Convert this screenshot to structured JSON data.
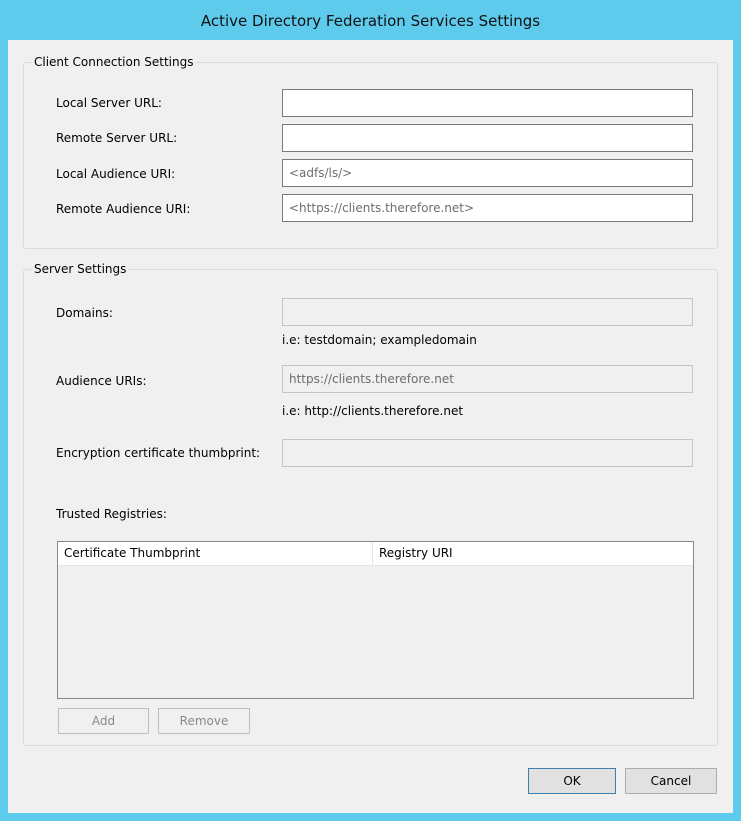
{
  "window": {
    "title": "Active Directory Federation Services Settings"
  },
  "client_connection": {
    "title": "Client Connection Settings",
    "local_server_url": {
      "label": "Local Server URL:",
      "value": ""
    },
    "remote_server_url": {
      "label": "Remote Server URL:",
      "value": ""
    },
    "local_audience_uri": {
      "label": "Local Audience URI:",
      "placeholder": "<adfs/ls/>"
    },
    "remote_audience_uri": {
      "label": "Remote Audience URI:",
      "placeholder": "<https://clients.therefore.net>"
    }
  },
  "server_settings": {
    "title": "Server Settings",
    "domains": {
      "label": "Domains:",
      "value": "",
      "hint": "i.e: testdomain; exampledomain"
    },
    "audience_uris": {
      "label": "Audience URIs:",
      "value": "https://clients.therefore.net",
      "hint": "i.e: http://clients.therefore.net"
    },
    "encryption_cert": {
      "label": "Encryption certificate thumbprint:",
      "value": ""
    },
    "trusted_registries": {
      "label": "Trusted Registries:",
      "columns": [
        "Certificate Thumbprint",
        "Registry URI"
      ],
      "rows": []
    },
    "add_label": "Add",
    "remove_label": "Remove"
  },
  "footer": {
    "ok_label": "OK",
    "cancel_label": "Cancel"
  }
}
